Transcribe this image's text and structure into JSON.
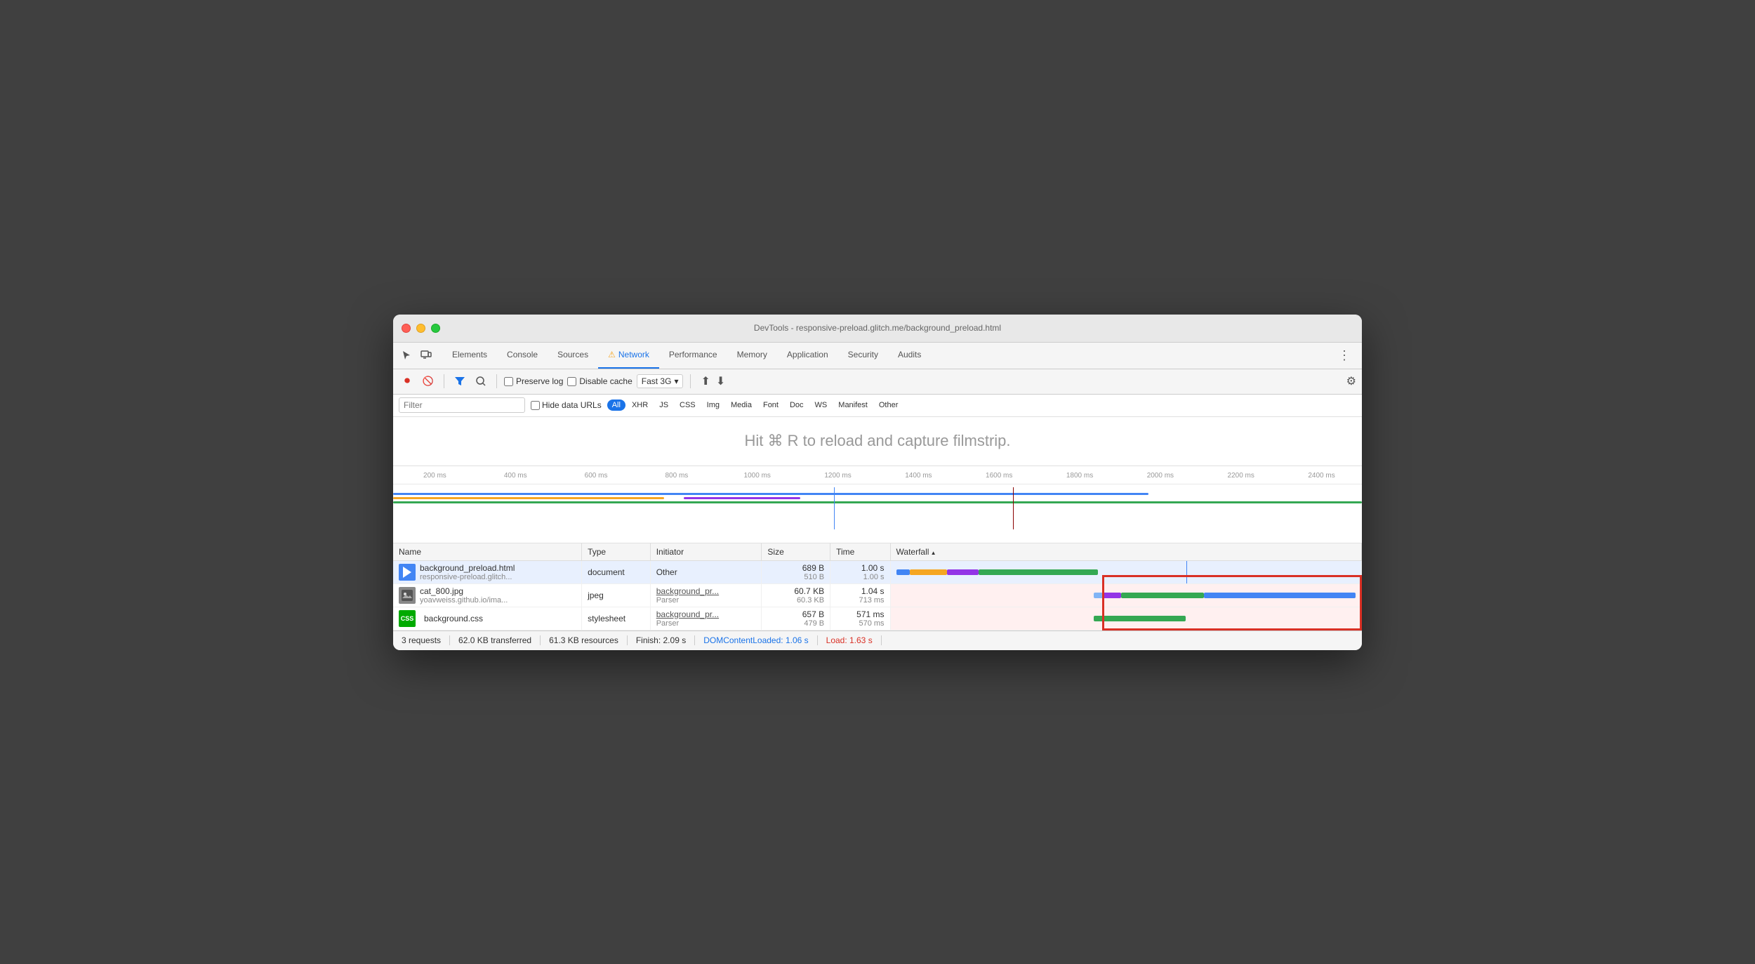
{
  "window": {
    "title": "DevTools - responsive-preload.glitch.me/background_preload.html"
  },
  "tabs": {
    "items": [
      {
        "label": "Elements",
        "active": false
      },
      {
        "label": "Console",
        "active": false
      },
      {
        "label": "Sources",
        "active": false
      },
      {
        "label": "Network",
        "active": true,
        "warn": true
      },
      {
        "label": "Performance",
        "active": false
      },
      {
        "label": "Memory",
        "active": false
      },
      {
        "label": "Application",
        "active": false
      },
      {
        "label": "Security",
        "active": false
      },
      {
        "label": "Audits",
        "active": false
      }
    ]
  },
  "toolbar": {
    "preserve_log": "Preserve log",
    "disable_cache": "Disable cache",
    "throttle": "Fast 3G",
    "settings_label": "Settings"
  },
  "filter": {
    "placeholder": "Filter",
    "hide_data_urls": "Hide data URLs",
    "types": [
      "All",
      "XHR",
      "JS",
      "CSS",
      "Img",
      "Media",
      "Font",
      "Doc",
      "WS",
      "Manifest",
      "Other"
    ]
  },
  "filmstrip": {
    "hint": "Hit ⌘ R to reload and capture filmstrip."
  },
  "timeline": {
    "labels": [
      "200 ms",
      "400 ms",
      "600 ms",
      "800 ms",
      "1000 ms",
      "1200 ms",
      "1400 ms",
      "1600 ms",
      "1800 ms",
      "2000 ms",
      "2200 ms",
      "2400 ms"
    ]
  },
  "table": {
    "headers": [
      "Name",
      "Type",
      "Initiator",
      "Size",
      "Time",
      "Waterfall"
    ],
    "rows": [
      {
        "name": "background_preload.html",
        "domain": "responsive-preload.glitch...",
        "type": "document",
        "initiator": "Other",
        "initiator_link": false,
        "size1": "689 B",
        "size2": "510 B",
        "time1": "1.00 s",
        "time2": "1.00 s",
        "selected": true
      },
      {
        "name": "cat_800.jpg",
        "domain": "yoavweiss.github.io/ima...",
        "type": "jpeg",
        "initiator": "background_pr...",
        "initiator2": "Parser",
        "initiator_link": true,
        "size1": "60.7 KB",
        "size2": "60.3 KB",
        "time1": "1.04 s",
        "time2": "713 ms",
        "selected": false
      },
      {
        "name": "background.css",
        "domain": "",
        "type": "stylesheet",
        "initiator": "background_pr...",
        "initiator2": "Parser",
        "initiator_link": true,
        "size1": "657 B",
        "size2": "479 B",
        "time1": "571 ms",
        "time2": "570 ms",
        "selected": false
      }
    ]
  },
  "status": {
    "requests": "3 requests",
    "transferred": "62.0 KB transferred",
    "resources": "61.3 KB resources",
    "finish": "Finish: 2.09 s",
    "dom_content_loaded": "DOMContentLoaded: 1.06 s",
    "load": "Load: 1.63 s"
  }
}
